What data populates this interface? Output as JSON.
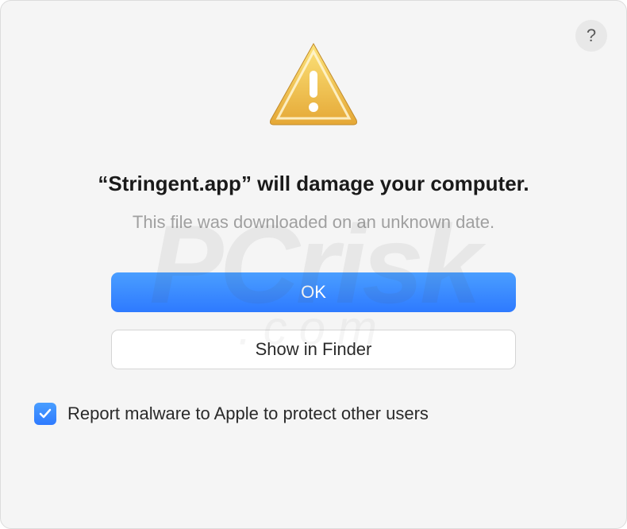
{
  "dialog": {
    "help_tooltip": "?",
    "title": "“Stringent.app” will damage your computer.",
    "subtitle": "This file was downloaded on an unknown date.",
    "primary_button": "OK",
    "secondary_button": "Show in Finder",
    "checkbox_label": "Report malware to Apple to protect other users",
    "checkbox_checked": true
  },
  "watermark": {
    "main": "PCrisk",
    "sub": ".com"
  }
}
